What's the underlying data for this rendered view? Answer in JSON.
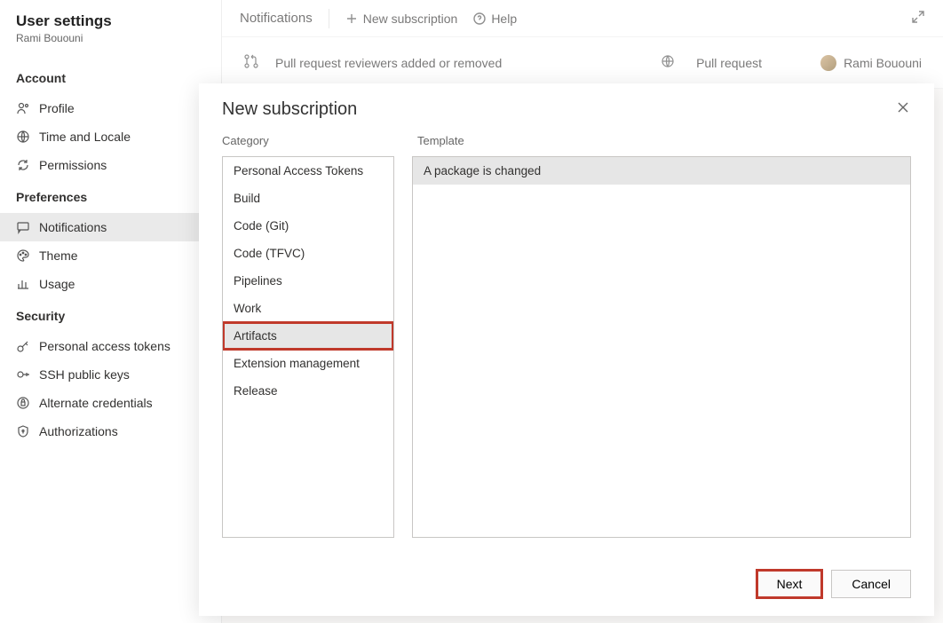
{
  "sidebar": {
    "title": "User settings",
    "user": "Rami Bououni",
    "sections": [
      {
        "label": "Account",
        "items": [
          {
            "icon": "person-icon",
            "label": "Profile"
          },
          {
            "icon": "globe-icon",
            "label": "Time and Locale"
          },
          {
            "icon": "refresh-icon",
            "label": "Permissions"
          }
        ]
      },
      {
        "label": "Preferences",
        "items": [
          {
            "icon": "chat-icon",
            "label": "Notifications",
            "active": true
          },
          {
            "icon": "paint-icon",
            "label": "Theme"
          },
          {
            "icon": "bar-chart-icon",
            "label": "Usage"
          }
        ]
      },
      {
        "label": "Security",
        "items": [
          {
            "icon": "key-icon",
            "label": "Personal access tokens"
          },
          {
            "icon": "ssh-key-icon",
            "label": "SSH public keys"
          },
          {
            "icon": "lock-icon",
            "label": "Alternate credentials"
          },
          {
            "icon": "shield-icon",
            "label": "Authorizations"
          }
        ]
      }
    ]
  },
  "toolbar": {
    "title": "Notifications",
    "new_label": "New subscription",
    "help_label": "Help"
  },
  "notification_row": {
    "description": "Pull request reviewers added or removed",
    "type": "Pull request",
    "user": "Rami Bououni"
  },
  "modal": {
    "title": "New subscription",
    "category_label": "Category",
    "template_label": "Template",
    "categories": [
      "Personal Access Tokens",
      "Build",
      "Code (Git)",
      "Code (TFVC)",
      "Pipelines",
      "Work",
      "Artifacts",
      "Extension management",
      "Release"
    ],
    "selected_category_index": 6,
    "templates": [
      "A package is changed"
    ],
    "selected_template_index": 0,
    "next_label": "Next",
    "cancel_label": "Cancel"
  }
}
